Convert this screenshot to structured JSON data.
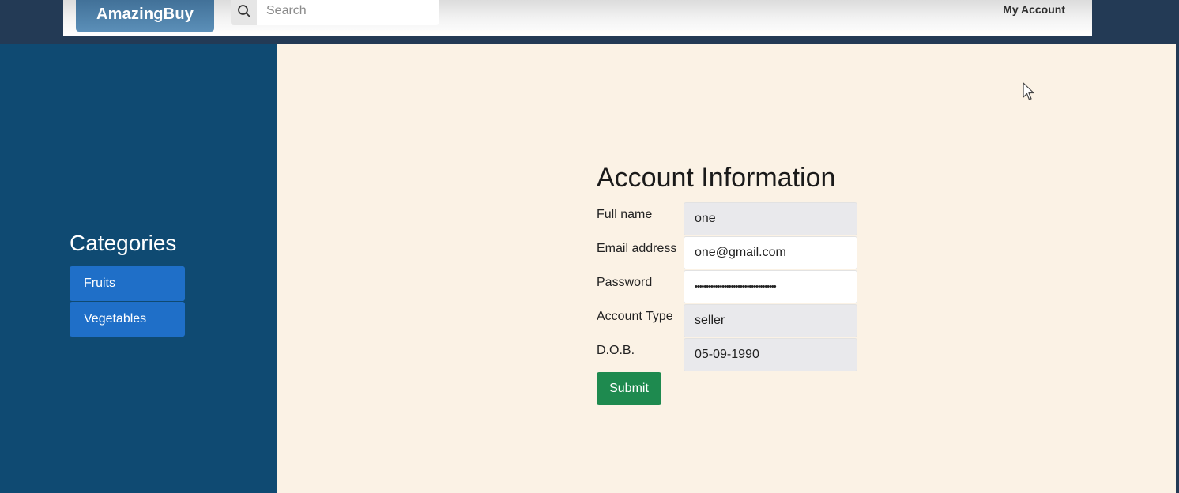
{
  "navbar": {
    "brand": "AmazingBuy",
    "search": {
      "placeholder": "Search",
      "value": "",
      "icon": "search-icon"
    },
    "my_account_label": "My Account"
  },
  "sidebar": {
    "title": "Categories",
    "items": [
      {
        "label": "Fruits"
      },
      {
        "label": "Vegetables"
      }
    ]
  },
  "form": {
    "title": "Account Information",
    "fields": [
      {
        "label": "Full name",
        "value": "one",
        "type": "text",
        "readonly": true
      },
      {
        "label": "Email address",
        "value": "one@gmail.com",
        "type": "text",
        "readonly": false
      },
      {
        "label": "Password",
        "value": "••••••••••••••••••••••••••••••••••••",
        "type": "password",
        "readonly": false
      },
      {
        "label": "Account Type",
        "value": "seller",
        "type": "text",
        "readonly": true
      },
      {
        "label": "D.O.B.",
        "value": "05-09-1990",
        "type": "text",
        "readonly": true
      }
    ],
    "submit_label": "Submit"
  },
  "colors": {
    "page_bg": "#233a55",
    "sidebar_bg": "#0f4a72",
    "main_bg": "#fbf2e5",
    "category_button": "#1f6fc8",
    "brand": "#4a7ea8",
    "submit_button": "#1e8a4f"
  }
}
